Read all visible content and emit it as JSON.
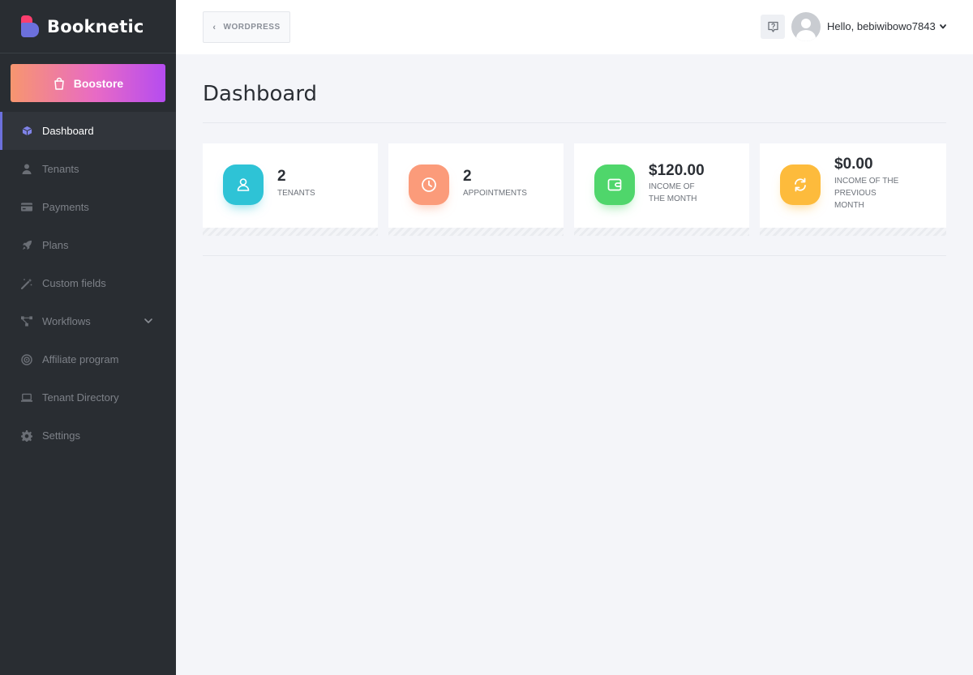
{
  "brand": {
    "name": "Booknetic"
  },
  "boostore": {
    "label": "Boostore"
  },
  "sidebar": {
    "items": [
      {
        "label": "Dashboard",
        "icon": "cube-icon",
        "active": true
      },
      {
        "label": "Tenants",
        "icon": "user-icon"
      },
      {
        "label": "Payments",
        "icon": "credit-card-icon"
      },
      {
        "label": "Plans",
        "icon": "rocket-icon"
      },
      {
        "label": "Custom fields",
        "icon": "magic-wand-icon"
      },
      {
        "label": "Workflows",
        "icon": "workflow-icon",
        "has_submenu": true
      },
      {
        "label": "Affiliate program",
        "icon": "target-icon"
      },
      {
        "label": "Tenant Directory",
        "icon": "laptop-icon"
      },
      {
        "label": "Settings",
        "icon": "gear-icon"
      }
    ]
  },
  "topbar": {
    "back_label": "WORDPRESS",
    "greeting": "Hello, bebiwibowo7843"
  },
  "page": {
    "title": "Dashboard"
  },
  "stats": [
    {
      "value": "2",
      "label": "TENANTS",
      "color": "#2ec3d6",
      "icon": "user-icon"
    },
    {
      "value": "2",
      "label": "APPOINTMENTS",
      "color": "#fb9b7a",
      "icon": "clock-icon"
    },
    {
      "value": "$120.00",
      "label_lines": [
        "INCOME OF",
        "THE MONTH"
      ],
      "color": "#4fd66b",
      "icon": "wallet-icon"
    },
    {
      "value": "$0.00",
      "label_lines": [
        "INCOME OF THE",
        "PREVIOUS",
        "MONTH"
      ],
      "color": "#fdbb3c",
      "icon": "refresh-icon"
    }
  ],
  "colors": {
    "sidebar_bg": "#292d32",
    "accent": "#6c70dc",
    "page_bg": "#f4f5f9"
  }
}
